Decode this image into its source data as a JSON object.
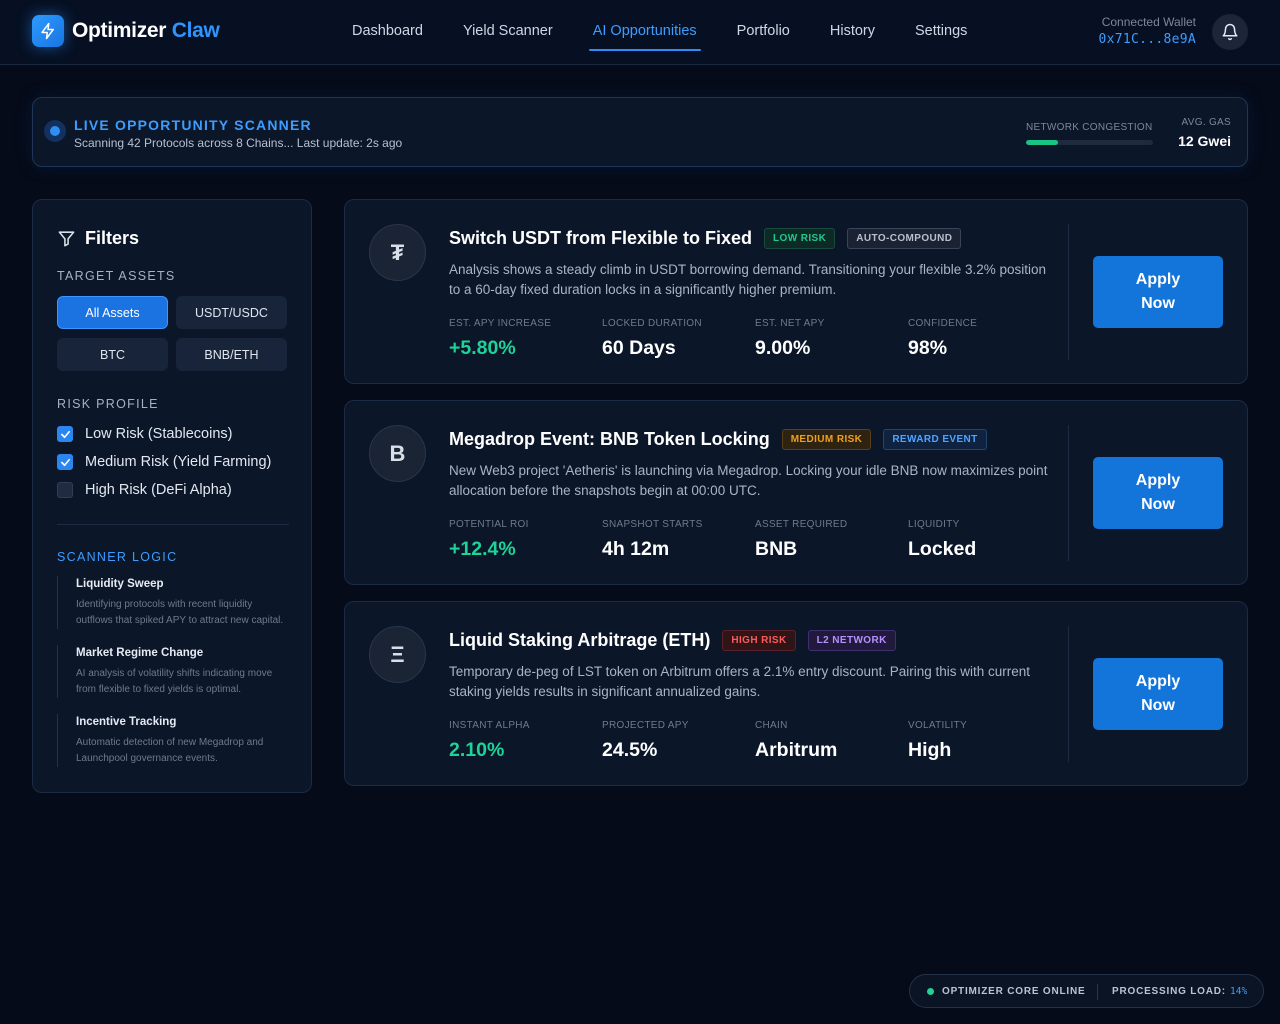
{
  "app": {
    "brand_part1": "Optimizer",
    "brand_part2": "Claw",
    "accent_color": "#2e8df5",
    "brand_icon": "lightning-icon"
  },
  "nav": {
    "items": [
      "Dashboard",
      "Yield Scanner",
      "AI Opportunities",
      "Portfolio",
      "History",
      "Settings"
    ],
    "active": "AI Opportunities"
  },
  "wallet": {
    "label": "Connected Wallet",
    "address": "0x71C...8e9A",
    "icon": "bell-icon"
  },
  "scanner": {
    "title": "LIVE OPPORTUNITY SCANNER",
    "subtitle": "Scanning 42 Protocols across 8 Chains... Last update: 2s ago",
    "congestion_label": "NETWORK CONGESTION",
    "congestion_level": 0.25,
    "gas_label": "AVG. GAS",
    "gas_value": "12 Gwei"
  },
  "filters": {
    "title": "Filters",
    "icon": "filter-icon",
    "target_assets_label": "TARGET ASSETS",
    "assets": [
      "All Assets",
      "USDT/USDC",
      "BTC",
      "BNB/ETH"
    ],
    "active_asset": "All Assets",
    "risk_profile_label": "RISK PROFILE",
    "risks": [
      {
        "label": "Low Risk (Stablecoins)",
        "checked": true
      },
      {
        "label": "Medium Risk (Yield Farming)",
        "checked": true
      },
      {
        "label": "High Risk (DeFi Alpha)",
        "checked": false
      }
    ],
    "scanner_logic_label": "SCANNER LOGIC",
    "logic": [
      {
        "title": "Liquidity Sweep",
        "desc": "Identifying protocols with recent liquidity outflows that spiked APY to attract new capital."
      },
      {
        "title": "Market Regime Change",
        "desc": "AI analysis of volatility shifts indicating move from flexible to fixed yields is optimal."
      },
      {
        "title": "Incentive Tracking",
        "desc": "Automatic detection of new Megadrop and Launchpool governance events."
      }
    ]
  },
  "opportunities": [
    {
      "icon_glyph": "₮",
      "icon": "tether-icon",
      "title": "Switch USDT from Flexible to Fixed",
      "tags": [
        "LOW RISK",
        "AUTO-COMPOUND"
      ],
      "desc": "Analysis shows a steady climb in USDT borrowing demand. Transitioning your flexible 3.2% position to a 60-day fixed duration locks in a significantly higher premium.",
      "metrics": [
        {
          "label": "EST. APY INCREASE",
          "value": "+5.80%"
        },
        {
          "label": "LOCKED DURATION",
          "value": "60 Days"
        },
        {
          "label": "EST. NET APY",
          "value": "9.00%"
        },
        {
          "label": "CONFIDENCE",
          "value": "98%"
        }
      ],
      "button": "Apply Now"
    },
    {
      "icon_glyph": "B",
      "icon": "bnb-icon",
      "title": "Megadrop Event: BNB Token Locking",
      "tags": [
        "MEDIUM RISK",
        "REWARD EVENT"
      ],
      "desc": "New Web3 project 'Aetheris' is launching via Megadrop. Locking your idle BNB now maximizes point allocation before the snapshots begin at 00:00 UTC.",
      "metrics": [
        {
          "label": "POTENTIAL ROI",
          "value": "+12.4%"
        },
        {
          "label": "SNAPSHOT STARTS",
          "value": "4h 12m"
        },
        {
          "label": "ASSET REQUIRED",
          "value": "BNB"
        },
        {
          "label": "LIQUIDITY",
          "value": "Locked"
        }
      ],
      "button": "Apply Now"
    },
    {
      "icon_glyph": "Ξ",
      "icon": "ethereum-icon",
      "title": "Liquid Staking Arbitrage (ETH)",
      "tags": [
        "HIGH RISK",
        "L2 NETWORK"
      ],
      "desc": "Temporary de-peg of LST token on Arbitrum offers a 2.1% entry discount. Pairing this with current staking yields results in significant annualized gains.",
      "metrics": [
        {
          "label": "INSTANT ALPHA",
          "value": "2.10%"
        },
        {
          "label": "PROJECTED APY",
          "value": "24.5%"
        },
        {
          "label": "CHAIN",
          "value": "Arbitrum"
        },
        {
          "label": "VOLATILITY",
          "value": "High"
        }
      ],
      "button": "Apply Now"
    }
  ],
  "status": {
    "core": "OPTIMIZER CORE ONLINE",
    "load_label": "PROCESSING LOAD:",
    "load_value": "14%"
  }
}
